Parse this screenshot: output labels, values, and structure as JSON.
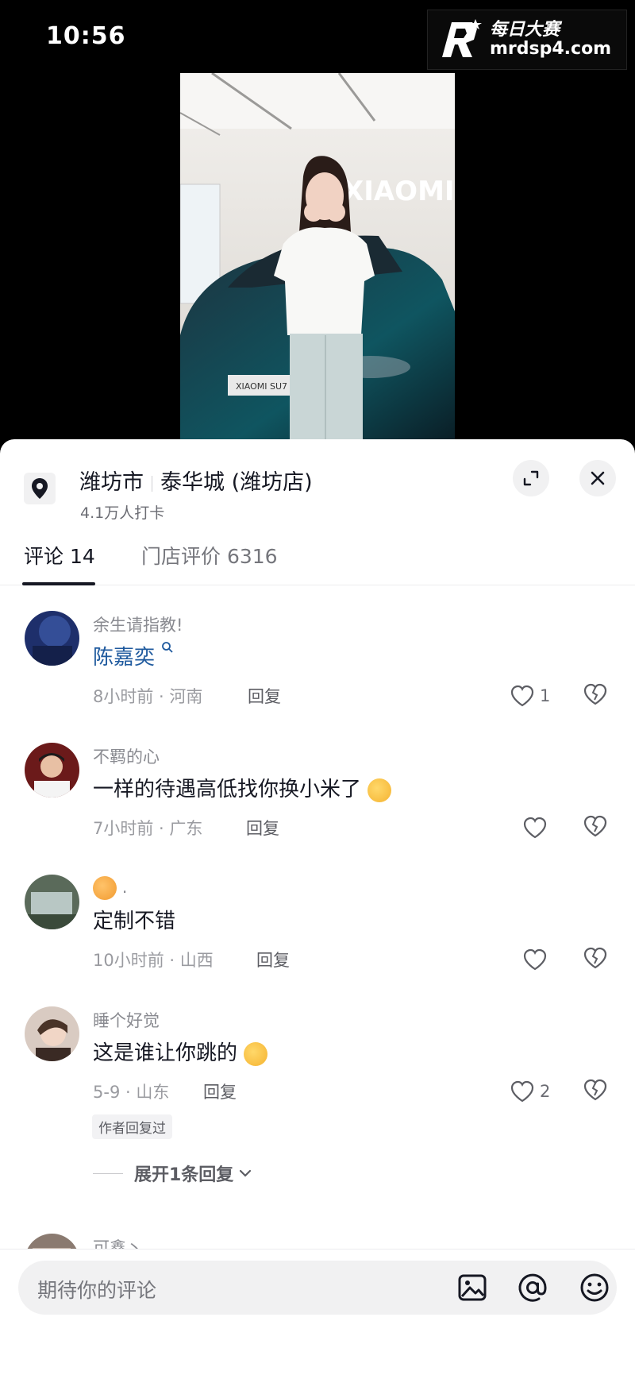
{
  "status_bar": {
    "time": "10:56"
  },
  "watermark": {
    "line1": "每日大赛",
    "line2": "mrdsp4.com",
    "logo_letter": "R"
  },
  "video": {
    "brand_text": "XIAOMI",
    "plate_text": "XIAOMI SU7"
  },
  "location": {
    "city": "潍坊市",
    "store": "泰华城 (潍坊店)",
    "checkins": "4.1万人打卡"
  },
  "tabs": [
    {
      "label": "评论 14",
      "active": true
    },
    {
      "label": "门店评价 6316",
      "active": false
    }
  ],
  "comments": [
    {
      "user": "余生请指教!",
      "text": "陈嘉奕",
      "text_is_link": true,
      "meta": "8小时前 · 河南",
      "reply": "回复",
      "likes": "1"
    },
    {
      "user": "不羁的心",
      "text": "一样的待遇高低找你换小米了",
      "meta": "7小时前 · 广东",
      "reply": "回复",
      "likes": ""
    },
    {
      "user": ".",
      "text": "定制不错",
      "meta": "10小时前 · 山西",
      "reply": "回复",
      "likes": ""
    },
    {
      "user": "睡个好觉",
      "text": "这是谁让你跳的",
      "meta": "5-9 · 山东",
      "reply": "回复",
      "likes": "2",
      "author_tag": "作者回复过",
      "expand_label": "展开1条回复"
    },
    {
      "user": "可鑫丶"
    }
  ],
  "input": {
    "placeholder": "期待你的评论"
  },
  "colors": {
    "link": "#1f5a9e",
    "text": "#161823",
    "muted": "#8a8b91"
  }
}
